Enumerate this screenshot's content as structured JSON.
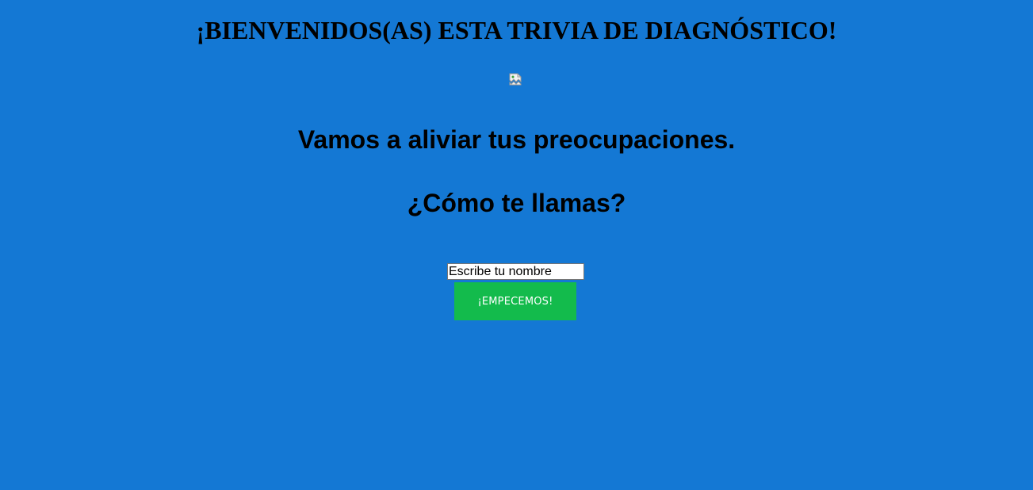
{
  "header": {
    "title": "¡BIENVENIDOS(AS) ESTA TRIVIA DE DIAGNÓSTICO!"
  },
  "intro": {
    "line1": "Vamos a aliviar tus preocupaciones.",
    "line2": "¿Cómo te llamas?"
  },
  "form": {
    "name_placeholder": "Escribe tu nombre",
    "name_value": "",
    "start_label": "¡EMPECEMOS!"
  },
  "colors": {
    "background": "#1478d4",
    "button": "#13bb4c"
  },
  "icons": {
    "image": "broken-image-icon"
  }
}
